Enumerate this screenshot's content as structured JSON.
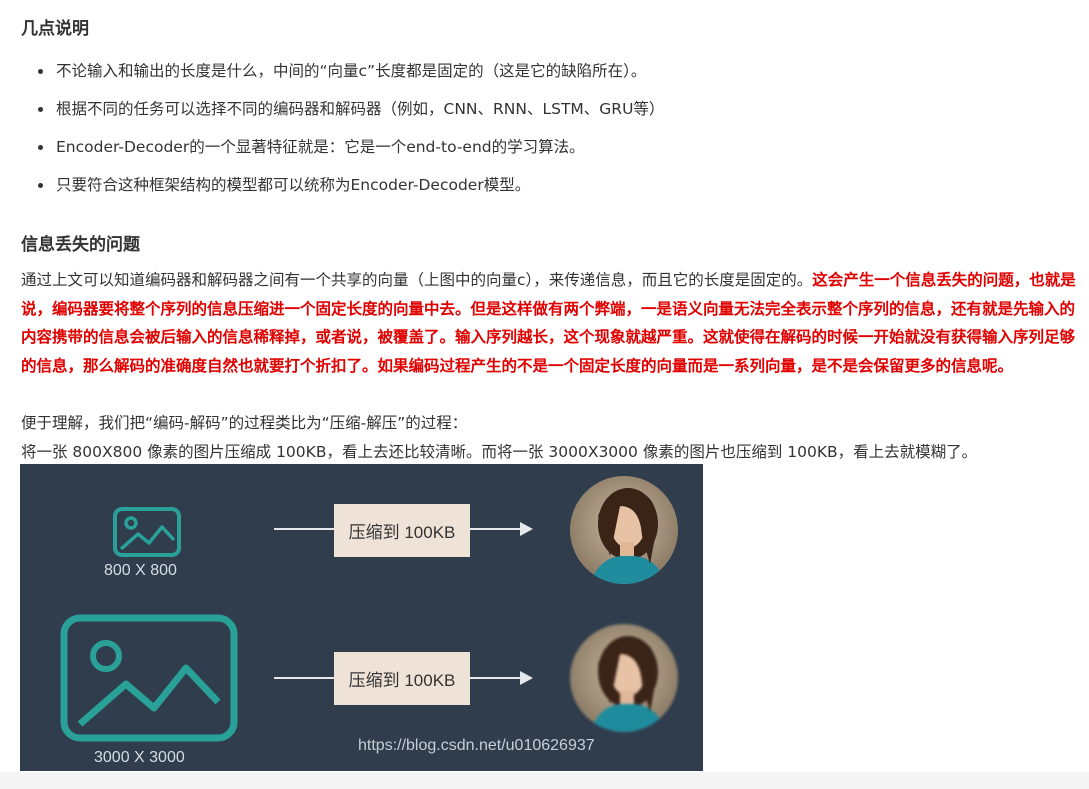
{
  "section1": {
    "heading": "几点说明",
    "bullets": [
      "不论输入和输出的长度是什么，中间的“向量c”长度都是固定的（这是它的缺陷所在）。",
      "根据不同的任务可以选择不同的编码器和解码器（例如，CNN、RNN、LSTM、GRU等）",
      "Encoder-Decoder的一个显著特征就是：它是一个end-to-end的学习算法。",
      "只要符合这种框架结构的模型都可以统称为Encoder-Decoder模型。"
    ]
  },
  "section2": {
    "heading": "信息丢失的问题",
    "para_normal": "通过上文可以知道编码器和解码器之间有一个共享的向量（上图中的向量c），来传递信息，而且它的长度是固定的。",
    "para_red": "这会产生一个信息丢失的问题，也就是说，编码器要将整个序列的信息压缩进一个固定长度的向量中去。但是这样做有两个弊端，一是语义向量无法完全表示整个序列的信息，还有就是先输入的内容携带的信息会被后输入的信息稀释掉，或者说，被覆盖了。输入序列越长，这个现象就越严重。这就使得在解码的时候一开始就没有获得输入序列足够的信息，那么解码的准确度自然也就要打个折扣了。如果编码过程产生的不是一个固定长度的向量而是一系列向量，是不是会保留更多的信息呢。",
    "line1": "便于理解，我们把“编码-解码”的过程类比为“压缩-解压”的过程：",
    "line2": "将一张 800X800 像素的图片压缩成 100KB，看上去还比较清晰。而将一张 3000X3000 像素的图片也压缩到 100KB，看上去就模糊了。"
  },
  "figure": {
    "small_label": "800 X 800",
    "large_label": "3000 X 3000",
    "compress_label_top": "压缩到 100KB",
    "compress_label_bottom": "压缩到 100KB",
    "watermark": "https://blog.csdn.net/u010626937",
    "colors": {
      "background": "#2f3d4d",
      "teal": "#2aa198",
      "box": "#efe3d8"
    }
  }
}
